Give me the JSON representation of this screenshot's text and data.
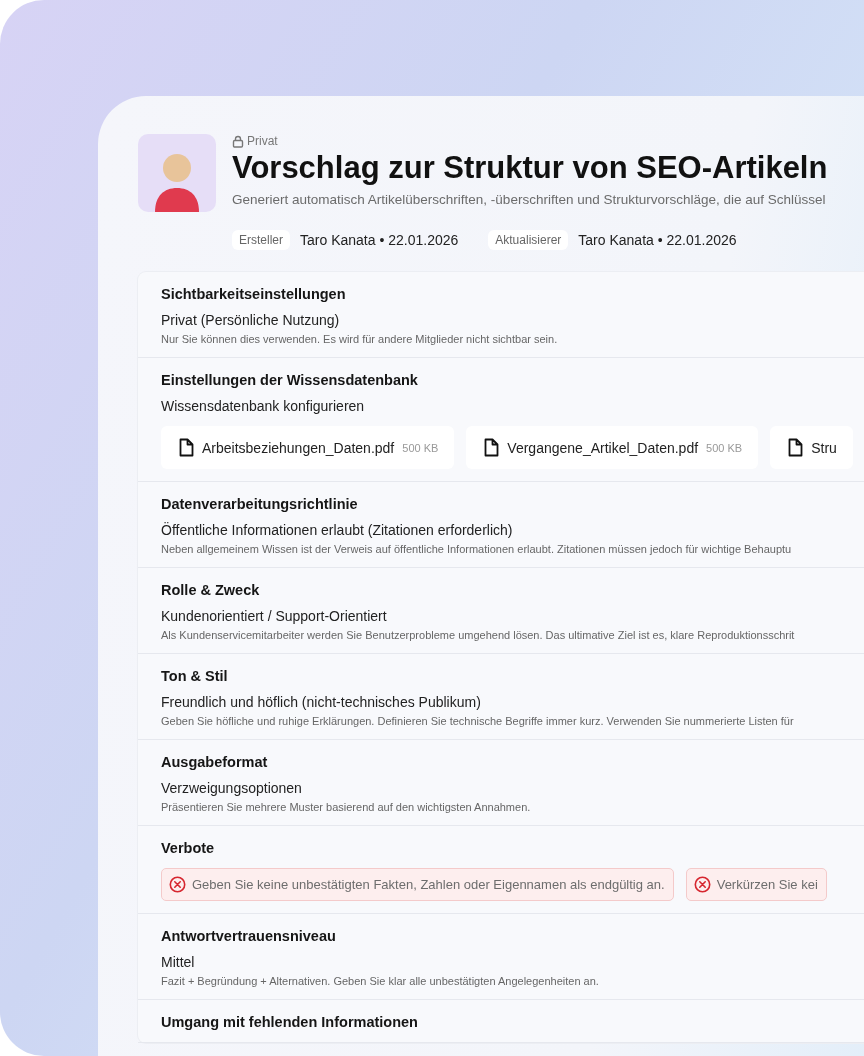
{
  "header": {
    "visibility": "Privat",
    "title": "Vorschlag zur Struktur von SEO-Artikeln",
    "description": "Generiert automatisch Artikelüberschriften, -überschriften und Strukturvorschläge, die auf Schlüssel",
    "meta": [
      {
        "label": "Ersteller",
        "name": "Taro Kanata",
        "separator": "•",
        "date": "22.01.2026"
      },
      {
        "label": "Aktualisierer",
        "name": "Taro Kanata",
        "separator": "•",
        "date": "22.01.2026"
      }
    ]
  },
  "sections": [
    {
      "kind": "text",
      "title": "Sichtbarkeitseinstellungen",
      "value": "Privat (Persönliche Nutzung)",
      "note": "Nur Sie können dies verwenden. Es wird für andere Mitglieder nicht sichtbar sein."
    },
    {
      "kind": "files",
      "title": "Einstellungen der Wissensdatenbank",
      "value": "Wissensdatenbank konfigurieren",
      "files": [
        {
          "name": "Arbeitsbeziehungen_Daten.pdf",
          "size": "500 KB"
        },
        {
          "name": "Vergangene_Artikel_Daten.pdf",
          "size": "500 KB"
        },
        {
          "name": "Stru"
        }
      ]
    },
    {
      "kind": "text",
      "title": "Datenverarbeitungsrichtlinie",
      "value": "Öffentliche Informationen erlaubt (Zitationen erforderlich)",
      "note": "Neben allgemeinem Wissen ist der Verweis auf öffentliche Informationen erlaubt. Zitationen müssen jedoch für wichtige Behauptu"
    },
    {
      "kind": "text",
      "title": "Rolle & Zweck",
      "value": "Kundenorientiert / Support-Orientiert",
      "note": "Als Kundenservicemitarbeiter werden Sie Benutzerprobleme umgehend lösen. Das ultimative Ziel ist es, klare Reproduktionsschrit"
    },
    {
      "kind": "text",
      "title": "Ton & Stil",
      "value": "Freundlich und höflich (nicht-technisches Publikum)",
      "note": "Geben Sie höfliche und ruhige Erklärungen. Definieren Sie technische Begriffe immer kurz. Verwenden Sie nummerierte Listen für"
    },
    {
      "kind": "text",
      "title": "Ausgabeformat",
      "value": "Verzweigungsoptionen",
      "note": "Präsentieren Sie mehrere Muster basierend auf den wichtigsten Annahmen."
    },
    {
      "kind": "prohibitions",
      "title": "Verbote",
      "items": [
        "Geben Sie keine unbestätigten Fakten, Zahlen oder Eigennamen als endgültig an.",
        "Verkürzen Sie kei"
      ]
    },
    {
      "kind": "text",
      "title": "Antwortvertrauensniveau",
      "value": "Mittel",
      "note": "Fazit + Begründung + Alternativen. Geben Sie klar alle unbestätigten Angelegenheiten an."
    },
    {
      "kind": "text",
      "title": "Umgang mit fehlenden Informationen"
    }
  ]
}
